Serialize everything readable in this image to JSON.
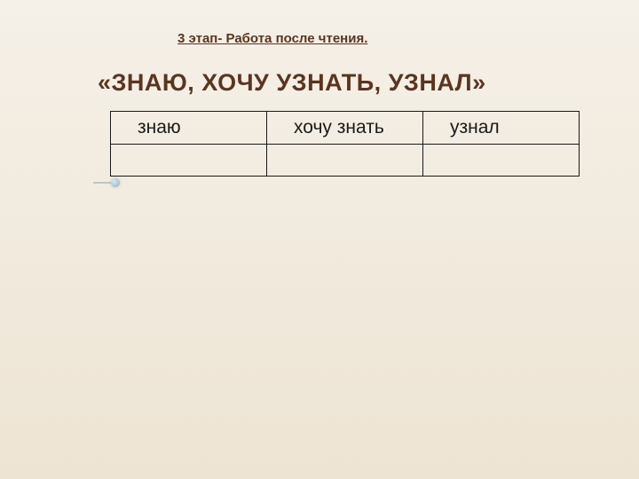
{
  "stage_text": "3 этап- Работа после чтения.",
  "title": "«ЗНАЮ, ХОЧУ УЗНАТЬ, УЗНАЛ»",
  "table": {
    "headers": [
      "знаю",
      "хочу знать",
      "узнал"
    ],
    "rows": [
      [
        "",
        "",
        ""
      ]
    ]
  }
}
